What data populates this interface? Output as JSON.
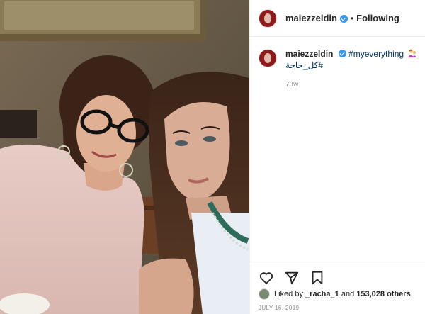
{
  "post": {
    "username": "maiezzeldin",
    "follow_status": "Following",
    "separator": "•",
    "caption_hashtag": "#myeverything",
    "caption_hashtag_arabic": "#كل_حاجة",
    "time_ago": "73w",
    "liked_by_prefix": "Liked by",
    "liked_by_user": "_racha_1",
    "liked_by_middle": "and",
    "likes_count": "153,028 others",
    "date": "JULY 16, 2019"
  },
  "icons": {
    "like": "heart-icon",
    "share": "paper-plane-icon",
    "save": "bookmark-icon",
    "verified": "verified-badge-icon"
  },
  "colors": {
    "verified_blue": "#3897f0",
    "hashtag": "#00376b",
    "muted_text": "#8e8e8e"
  }
}
